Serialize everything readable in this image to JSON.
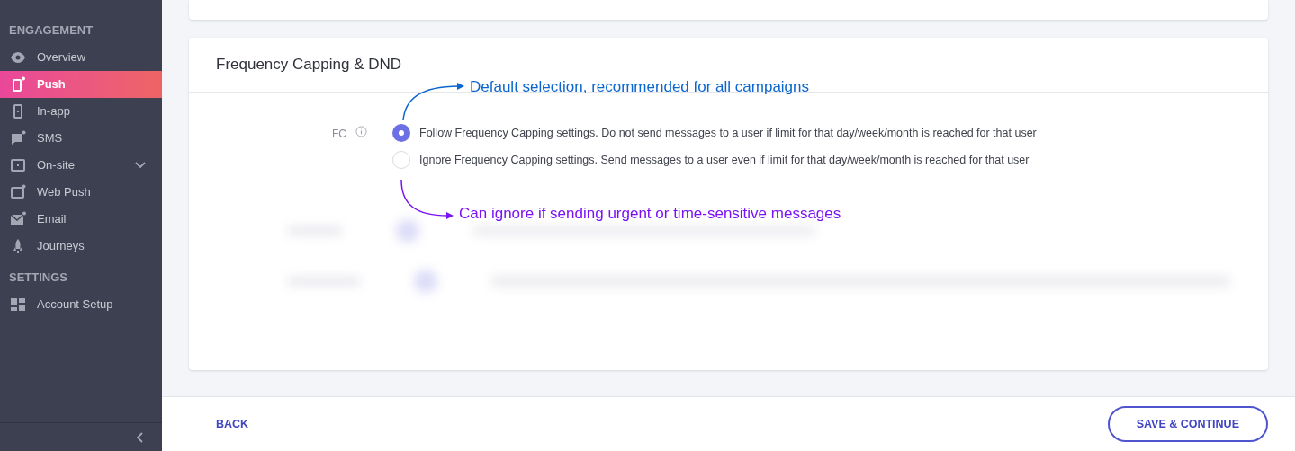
{
  "sidebar": {
    "sections": [
      {
        "title": "ENGAGEMENT",
        "items": [
          {
            "label": "Overview",
            "selected": false,
            "expandable": false
          },
          {
            "label": "Push",
            "selected": true,
            "expandable": false
          },
          {
            "label": "In-app",
            "selected": false,
            "expandable": false
          },
          {
            "label": "SMS",
            "selected": false,
            "expandable": false
          },
          {
            "label": "On-site",
            "selected": false,
            "expandable": true
          },
          {
            "label": "Web Push",
            "selected": false,
            "expandable": false
          },
          {
            "label": "Email",
            "selected": false,
            "expandable": false
          },
          {
            "label": "Journeys",
            "selected": false,
            "expandable": false
          }
        ]
      },
      {
        "title": "SETTINGS",
        "items": [
          {
            "label": "Account Setup",
            "selected": false,
            "expandable": false
          }
        ]
      }
    ]
  },
  "card": {
    "title": "Frequency Capping & DND",
    "field_label": "FC",
    "options": [
      {
        "label": "Follow Frequency Capping settings. Do not send messages to a user if limit for that day/week/month is reached for that user",
        "selected": true
      },
      {
        "label": "Ignore Frequency Capping settings. Send messages to a user even if limit for that day/week/month is reached for that user",
        "selected": false
      }
    ]
  },
  "annotations": [
    {
      "text": "Default selection, recommended for all campaigns",
      "color": "#0b66d0"
    },
    {
      "text": "Can ignore if sending urgent or time-sensitive messages",
      "color": "#7a12f5"
    }
  ],
  "footer": {
    "back": "BACK",
    "primary": "SAVE & CONTINUE"
  }
}
